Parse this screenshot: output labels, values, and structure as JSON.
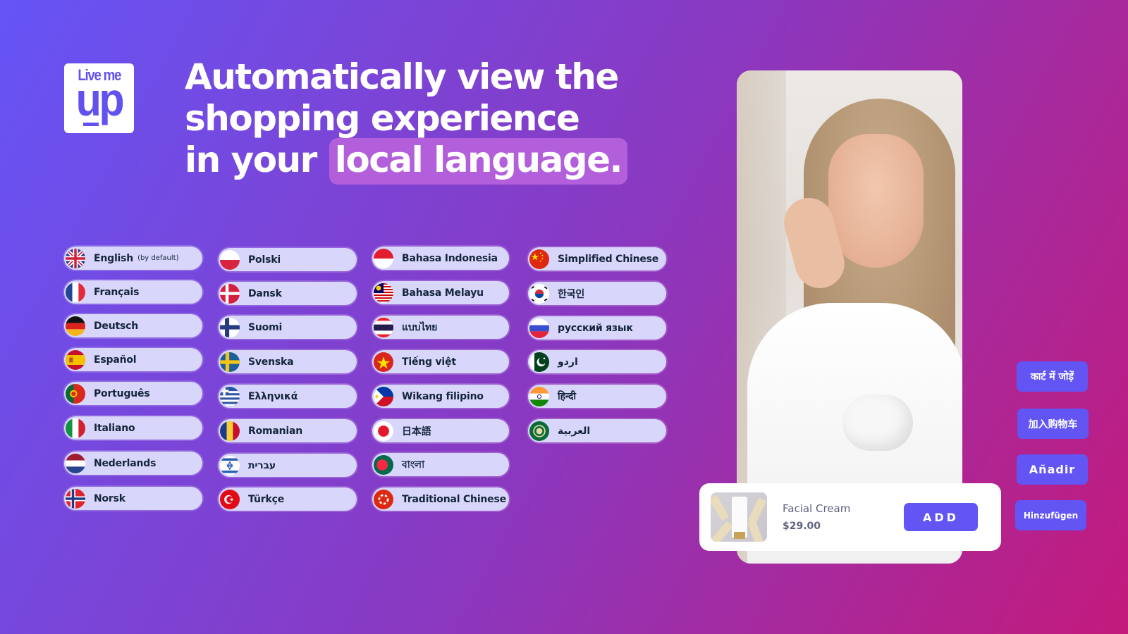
{
  "brand": {
    "logo_line1": "Live me",
    "logo_line2": "up"
  },
  "headline": {
    "line1": "Automatically view the",
    "line2": "shopping experience",
    "line3_prefix": "in your",
    "line3_highlight": "local language."
  },
  "languages": [
    [
      {
        "label": "English",
        "sub": "(by default)",
        "flag": "gb"
      },
      {
        "label": "Français",
        "flag": "fr"
      },
      {
        "label": "Deutsch",
        "flag": "de"
      },
      {
        "label": "Español",
        "flag": "es"
      },
      {
        "label": "Português",
        "flag": "pt"
      },
      {
        "label": "Italiano",
        "flag": "it"
      },
      {
        "label": "Nederlands",
        "flag": "nl"
      },
      {
        "label": "Norsk",
        "flag": "no"
      }
    ],
    [
      {
        "label": "Polski",
        "flag": "pl"
      },
      {
        "label": "Dansk",
        "flag": "dk"
      },
      {
        "label": "Suomi",
        "flag": "fi"
      },
      {
        "label": "Svenska",
        "flag": "se"
      },
      {
        "label": "Ελληνικά",
        "flag": "gr"
      },
      {
        "label": "Romanian",
        "flag": "ro"
      },
      {
        "label": "עברית",
        "flag": "il"
      },
      {
        "label": "Türkçe",
        "flag": "tr"
      }
    ],
    [
      {
        "label": "Bahasa Indonesia",
        "flag": "id"
      },
      {
        "label": "Bahasa Melayu",
        "flag": "my"
      },
      {
        "label": "แบบไทย",
        "flag": "th"
      },
      {
        "label": "Tiếng việt",
        "flag": "vn"
      },
      {
        "label": "Wikang filipino",
        "flag": "ph"
      },
      {
        "label": "日本語",
        "flag": "jp"
      },
      {
        "label": "বাংলা",
        "flag": "bd"
      },
      {
        "label": "Traditional Chinese",
        "flag": "hk"
      }
    ],
    [
      {
        "label": "Simplified Chinese",
        "flag": "cn"
      },
      {
        "label": "한국인",
        "flag": "kr"
      },
      {
        "label": "русский язык",
        "flag": "ru"
      },
      {
        "label": "اردو",
        "flag": "pk"
      },
      {
        "label": "हिन्दी",
        "flag": "in"
      },
      {
        "label": "العربية",
        "flag": "arab"
      }
    ]
  ],
  "product": {
    "name": "Facial Cream",
    "price": "$29.00",
    "add_label": "ADD"
  },
  "add_to_cart_translations": [
    "कार्ट में जोड़ें",
    "加入购物车",
    "Añadir",
    "Hinzufügen"
  ],
  "colors": {
    "accent": "#6255f4",
    "pill_bg": "#d8d6fb",
    "highlight": "#b35fdc",
    "gradient_start": "#6554f6",
    "gradient_end": "#c31a7c"
  }
}
